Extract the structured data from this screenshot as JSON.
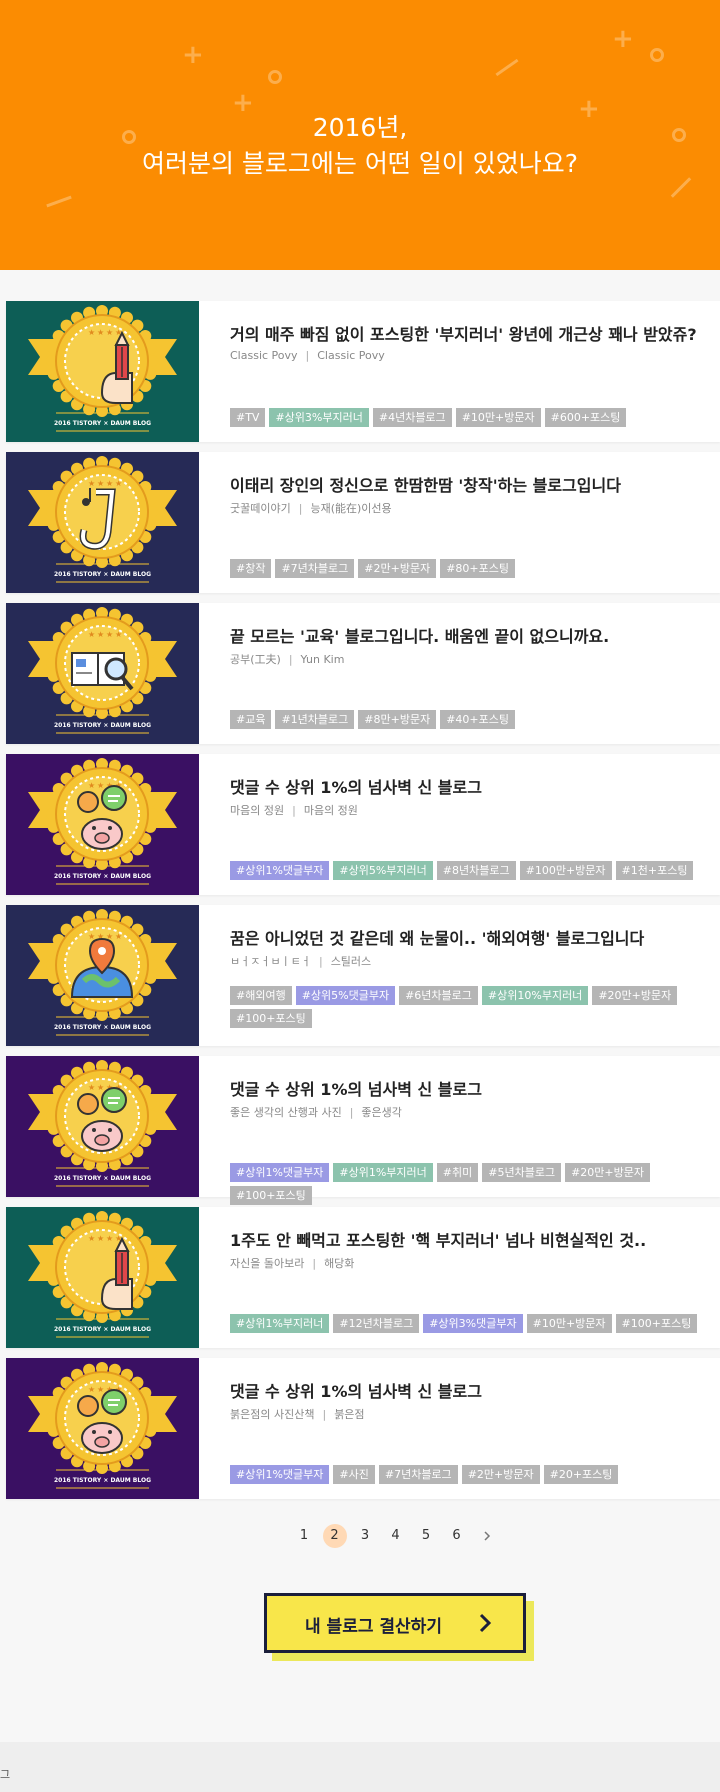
{
  "hero": {
    "line1": "2016년,",
    "line2": "여러분의 블로그에는 어떤 일이 있었나요?"
  },
  "badge_caption": "2016 TISTORY × DAUM BLOG",
  "cards": [
    {
      "title": "거의 매주 빠짐 없이 포스팅한 '부지러너' 왕년에 개근상 꽤나 받았쥬?",
      "blog": "Classic Povy",
      "author": "Classic Povy",
      "bg": "#0d5e56",
      "icon": "pencil-icon",
      "tags": [
        {
          "label": "#TV",
          "color": "gray"
        },
        {
          "label": "#상위3%부지러너",
          "color": "green"
        },
        {
          "label": "#4년차블로그",
          "color": "gray"
        },
        {
          "label": "#10만+방문자",
          "color": "gray"
        },
        {
          "label": "#600+포스팅",
          "color": "gray"
        }
      ]
    },
    {
      "title": "이태리 장인의 정신으로 한땀한땀 '창작'하는 블로그입니다",
      "blog": "굿꿀떼이야기",
      "author": "능재(能在)이선용",
      "bg": "#262a56",
      "icon": "saxophone-icon",
      "tags": [
        {
          "label": "#창작",
          "color": "gray"
        },
        {
          "label": "#7년차블로그",
          "color": "gray"
        },
        {
          "label": "#2만+방문자",
          "color": "gray"
        },
        {
          "label": "#80+포스팅",
          "color": "gray"
        }
      ]
    },
    {
      "title": "끝 모르는 '교육' 블로그입니다. 배움엔 끝이 없으니까요.",
      "blog": "공부(工夫)",
      "author": "Yun Kim",
      "bg": "#262a56",
      "icon": "book-magnifier-icon",
      "tags": [
        {
          "label": "#교육",
          "color": "gray"
        },
        {
          "label": "#1년차블로그",
          "color": "gray"
        },
        {
          "label": "#8만+방문자",
          "color": "gray"
        },
        {
          "label": "#40+포스팅",
          "color": "gray"
        }
      ]
    },
    {
      "title": "댓글 수 상위 1%의 넘사벽 신 블로그",
      "blog": "마음의 정원",
      "author": "마음의 정원",
      "bg": "#3a1063",
      "icon": "pig-speech-icon",
      "tags": [
        {
          "label": "#상위1%댓글부자",
          "color": "purple"
        },
        {
          "label": "#상위5%부지러너",
          "color": "green"
        },
        {
          "label": "#8년차블로그",
          "color": "gray"
        },
        {
          "label": "#100만+방문자",
          "color": "gray"
        },
        {
          "label": "#1천+포스팅",
          "color": "gray"
        }
      ]
    },
    {
      "title": "꿈은 아니었던 것 같은데 왜 눈물이.. '해외여행' 블로그입니다",
      "blog": "ㅂㅓㅈㅓㅂㅣㅌㅓ",
      "author": "스틸러스",
      "bg": "#262a56",
      "icon": "globe-pin-icon",
      "tags": [
        {
          "label": "#해외여행",
          "color": "gray"
        },
        {
          "label": "#상위5%댓글부자",
          "color": "purple"
        },
        {
          "label": "#6년차블로그",
          "color": "gray"
        },
        {
          "label": "#상위10%부지러너",
          "color": "green"
        },
        {
          "label": "#20만+방문자",
          "color": "gray"
        },
        {
          "label": "#100+포스팅",
          "color": "gray"
        }
      ]
    },
    {
      "title": "댓글 수 상위 1%의 넘사벽 신 블로그",
      "blog": "좋은 생각의 산행과 사진",
      "author": "좋은생각",
      "bg": "#3a1063",
      "icon": "pig-speech-icon",
      "tags": [
        {
          "label": "#상위1%댓글부자",
          "color": "purple"
        },
        {
          "label": "#상위1%부지러너",
          "color": "green"
        },
        {
          "label": "#취미",
          "color": "gray"
        },
        {
          "label": "#5년차블로그",
          "color": "gray"
        },
        {
          "label": "#20만+방문자",
          "color": "gray"
        },
        {
          "label": "#100+포스팅",
          "color": "gray"
        }
      ]
    },
    {
      "title": "1주도 안 빼먹고 포스팅한 '핵 부지러너' 넘나 비현실적인 것..",
      "blog": "자신을 돌아보라",
      "author": "해당화",
      "bg": "#0d5e56",
      "icon": "pencil-icon",
      "tags": [
        {
          "label": "#상위1%부지러너",
          "color": "green"
        },
        {
          "label": "#12년차블로그",
          "color": "gray"
        },
        {
          "label": "#상위3%댓글부자",
          "color": "purple"
        },
        {
          "label": "#10만+방문자",
          "color": "gray"
        },
        {
          "label": "#100+포스팅",
          "color": "gray"
        }
      ]
    },
    {
      "title": "댓글 수 상위 1%의 넘사벽 신 블로그",
      "blog": "붉은점의 사진산책",
      "author": "붉은점",
      "bg": "#3a1063",
      "icon": "pig-speech-icon",
      "tags": [
        {
          "label": "#상위1%댓글부자",
          "color": "purple"
        },
        {
          "label": "#사진",
          "color": "gray"
        },
        {
          "label": "#7년차블로그",
          "color": "gray"
        },
        {
          "label": "#2만+방문자",
          "color": "gray"
        },
        {
          "label": "#20+포스팅",
          "color": "gray"
        }
      ]
    }
  ],
  "pagination": {
    "pages": [
      "1",
      "2",
      "3",
      "4",
      "5",
      "6"
    ],
    "current": "2",
    "next_icon": "chevron-right-icon"
  },
  "cta": {
    "label": "내 블로그 결산하기",
    "icon": "chevron-right-icon"
  },
  "footer": {
    "text": "그"
  }
}
